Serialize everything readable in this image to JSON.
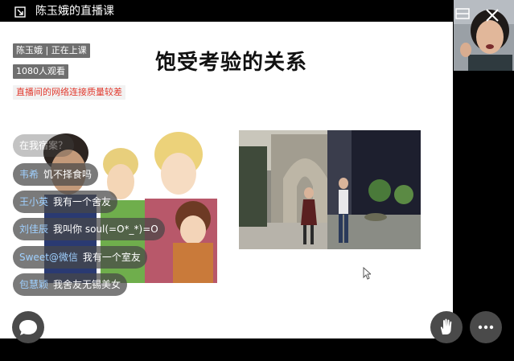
{
  "window": {
    "title": "陈玉娥的直播课"
  },
  "status": {
    "teacher_status": "陈玉娥 | 正在上课",
    "viewers": "1080人观看",
    "network_warning": "直播间的网络连接质量较差"
  },
  "slide": {
    "title": "饱受考验的关系"
  },
  "chat": {
    "partial_top": "在我宿案？",
    "messages": [
      {
        "name": "韦希",
        "text": "饥不择食吗"
      },
      {
        "name": "王小英",
        "text": "我有一个舍友"
      },
      {
        "name": "刘佳辰",
        "text": "我叫你 soul(=O*_*)=O"
      },
      {
        "name": "Sweet@微信",
        "text": "我有一个室友"
      },
      {
        "name": "包慧颖",
        "text": "我舍友无锡美女"
      }
    ]
  },
  "colors": {
    "badge_bg": "#6f6f6f",
    "warning_text": "#e23a2e",
    "chat_name": "#9fd0ff",
    "chat_bubble": "#464646"
  },
  "icons": {
    "minimize": "minimize-window-icon",
    "close": "close-icon",
    "pip_toggle": "picture-in-picture-icon",
    "chat": "chat-bubble-icon",
    "raise_hand": "raise-hand-icon",
    "more": "more-dots-icon"
  }
}
